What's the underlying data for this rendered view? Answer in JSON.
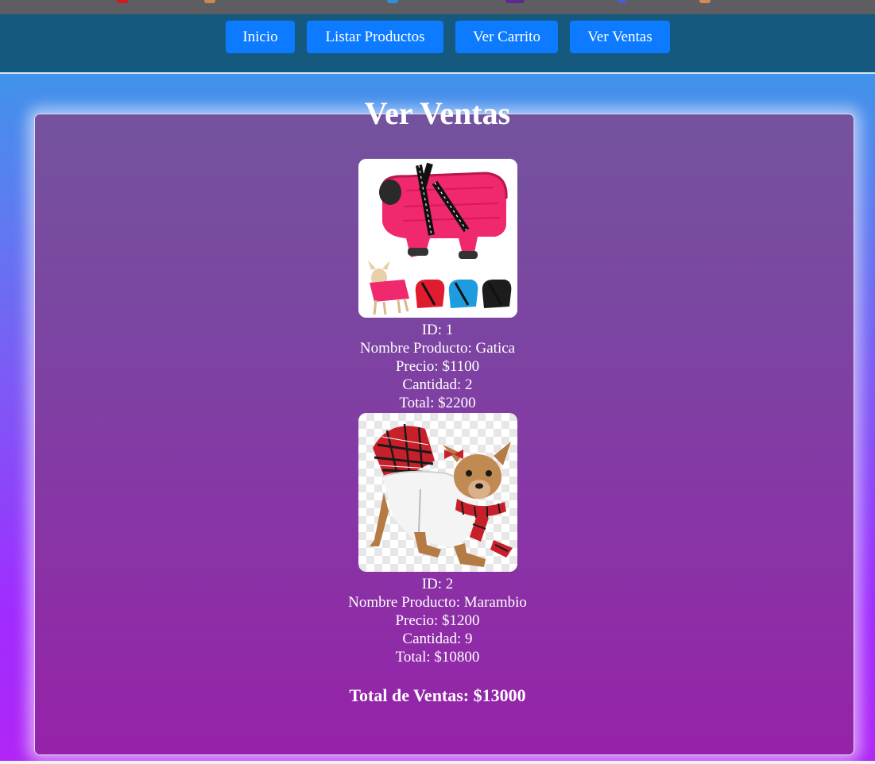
{
  "nav": {
    "buttons": [
      {
        "label": "Inicio"
      },
      {
        "label": "Listar Productos"
      },
      {
        "label": "Ver Carrito"
      },
      {
        "label": "Ver Ventas"
      }
    ]
  },
  "page": {
    "title": "Ver Ventas"
  },
  "sales": [
    {
      "image": "dog-puffer-coat-pink",
      "id_text": "ID: 1",
      "name_text": "Nombre Producto: Gatica",
      "price_text": "Precio: $1100",
      "quantity_text": "Cantidad: 2",
      "total_text": "Total: $2200"
    },
    {
      "image": "dog-plaid-skirt-outfit",
      "id_text": "ID: 2",
      "name_text": "Nombre Producto: Marambio",
      "price_text": "Precio: $1200",
      "quantity_text": "Cantidad: 9",
      "total_text": "Total: $10800"
    }
  ],
  "summary": {
    "total_text": "Total de Ventas: $13000"
  },
  "colors": {
    "nav_bg": "#16597e",
    "button_bg": "#0c7bff",
    "panel_top": "#74539e",
    "panel_bottom": "#9622a9"
  }
}
